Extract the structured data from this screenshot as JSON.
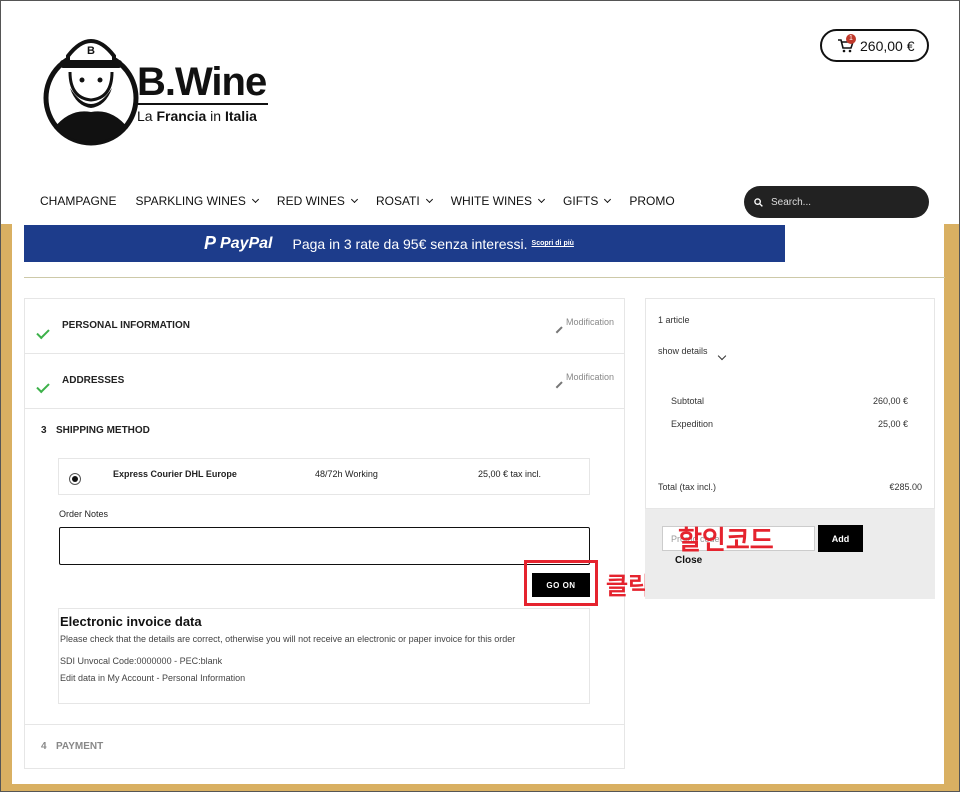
{
  "header": {
    "brand": "B.Wine",
    "tagline_prefix": "La ",
    "tagline_bold1": "Francia",
    "tagline_mid": " in ",
    "tagline_bold2": "Italia",
    "cart_count": "1",
    "cart_total": "260,00 €"
  },
  "nav": {
    "items": [
      "CHAMPAGNE",
      "SPARKLING WINES",
      "RED WINES",
      "ROSATI",
      "WHITE WINES",
      "GIFTS",
      "PROMO"
    ],
    "search_placeholder": "Search..."
  },
  "paypal_banner": {
    "logo": "PayPal",
    "text": "Paga in 3 rate da 95€ senza interessi.",
    "link": "Scopri di più"
  },
  "checkout": {
    "step1_title": "PERSONAL INFORMATION",
    "step2_title": "ADDRESSES",
    "modify_label": "Modification",
    "step3_number": "3",
    "step3_title": "SHIPPING METHOD",
    "carrier_name": "Express Courier DHL Europe",
    "carrier_delay": "48/72h Working",
    "carrier_price": "25,00 € tax incl.",
    "order_notes_label": "Order Notes",
    "go_on_label": "GO ON",
    "invoice_title": "Electronic invoice data",
    "invoice_note": "Please check that the details are correct, otherwise you will not receive an electronic or paper invoice for this order",
    "invoice_code": "SDI Unvocal Code:0000000 - PEC:blank",
    "invoice_edit": "Edit data in My Account - Personal Information",
    "step4_number": "4",
    "step4_title": "PAYMENT"
  },
  "summary": {
    "articles": "1 article",
    "show_details": "show details",
    "subtotal_label": "Subtotal",
    "subtotal_value": "260,00 €",
    "expedition_label": "Expedition",
    "expedition_value": "25,00 €",
    "total_label": "Total (tax incl.)",
    "total_value": "€285.00",
    "promo_placeholder": "Promo code",
    "add_label": "Add",
    "close_label": "Close"
  },
  "annotations": {
    "promo_note": "할인코드",
    "click_note": "클릭",
    "color": "#e5232e"
  }
}
